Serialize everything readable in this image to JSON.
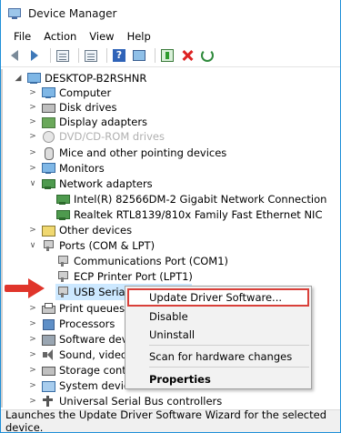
{
  "window": {
    "title": "Device Manager"
  },
  "menu": [
    "File",
    "Action",
    "View",
    "Help"
  ],
  "toolbar": {
    "back_icon": "back-arrow-icon",
    "forward_icon": "forward-arrow-icon",
    "help_glyph": "?"
  },
  "tree": {
    "root": "DESKTOP-B2RSHNR",
    "categories": [
      {
        "label": "Computer",
        "icon": "computer-icon",
        "expanded": false
      },
      {
        "label": "Disk drives",
        "icon": "disk-icon",
        "expanded": false
      },
      {
        "label": "Display adapters",
        "icon": "display-icon",
        "expanded": false
      },
      {
        "label": "DVD/CD-ROM drives",
        "icon": "dvd-icon",
        "expanded": false,
        "faded": true
      },
      {
        "label": "Mice and other pointing devices",
        "icon": "mouse-icon",
        "expanded": false
      },
      {
        "label": "Monitors",
        "icon": "monitor-icon",
        "expanded": false
      },
      {
        "label": "Network adapters",
        "icon": "network-icon",
        "expanded": true,
        "children": [
          "Intel(R) 82566DM-2 Gigabit Network Connection",
          "Realtek RTL8139/810x Family Fast Ethernet NIC"
        ]
      },
      {
        "label": "Other devices",
        "icon": "other-icon",
        "expanded": false
      },
      {
        "label": "Ports (COM & LPT)",
        "icon": "port-icon",
        "expanded": true,
        "children": [
          "Communications Port (COM1)",
          "ECP Printer Port (LPT1)",
          "USB Serial Device (COM5)"
        ]
      },
      {
        "label": "Print queues",
        "icon": "printer-icon",
        "expanded": false
      },
      {
        "label": "Processors",
        "icon": "processor-icon",
        "expanded": false
      },
      {
        "label": "Software devices",
        "icon": "software-icon",
        "expanded": false
      },
      {
        "label": "Sound, video and game controllers",
        "icon": "sound-icon",
        "expanded": false
      },
      {
        "label": "Storage controllers",
        "icon": "storage-icon",
        "expanded": false
      },
      {
        "label": "System devices",
        "icon": "system-icon",
        "expanded": false
      },
      {
        "label": "Universal Serial Bus controllers",
        "icon": "usb-icon",
        "expanded": false
      }
    ]
  },
  "context_menu": {
    "update": "Update Driver Software...",
    "disable": "Disable",
    "uninstall": "Uninstall",
    "scan": "Scan for hardware changes",
    "properties": "Properties"
  },
  "status": "Launches the Update Driver Software Wizard for the selected device.",
  "colors": {
    "accent": "#1e8fd8",
    "highlight_border": "#d9403a",
    "arrow": "#e0352b",
    "selection": "#cce8ff"
  }
}
